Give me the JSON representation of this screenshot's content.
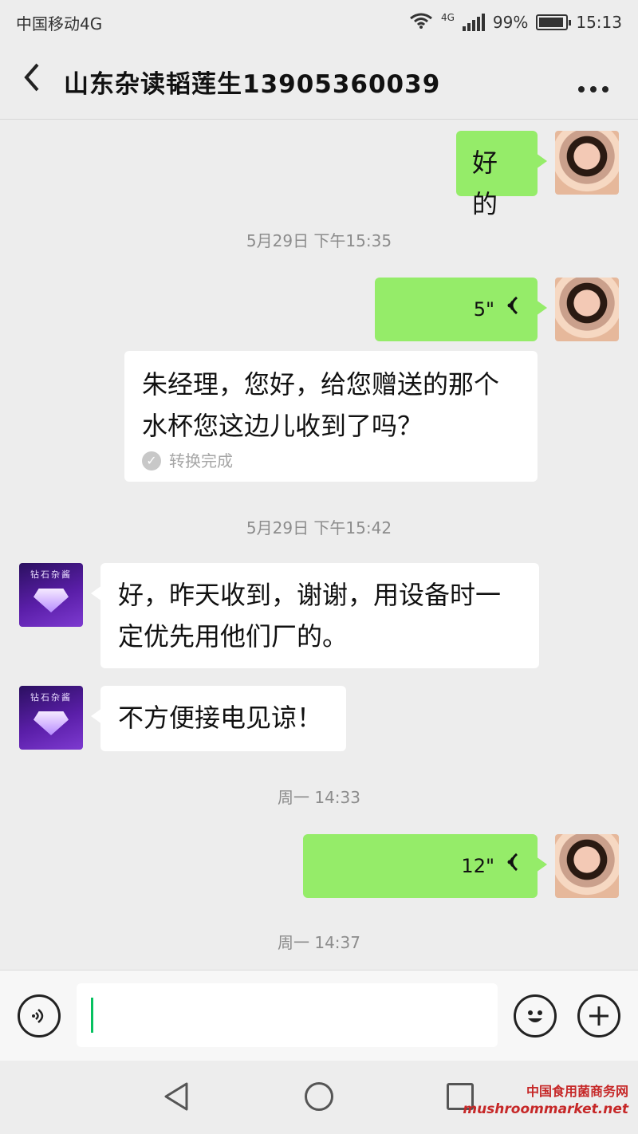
{
  "status_bar": {
    "carrier": "中国移动4G",
    "network": "4G",
    "battery": "99%",
    "time": "15:13"
  },
  "header": {
    "title": "山东杂读韬莲生13905360039"
  },
  "messages": [
    {
      "type": "text",
      "side": "right",
      "text": "好的"
    },
    {
      "type": "timestamp",
      "text": "5月29日 下午15:35"
    },
    {
      "type": "voice",
      "side": "right",
      "duration": "5\""
    },
    {
      "type": "transcript",
      "text": "朱经理，您好，给您赠送的那个水杯您这边儿收到了吗？",
      "status": "转换完成"
    },
    {
      "type": "timestamp",
      "text": "5月29日 下午15:42"
    },
    {
      "type": "text",
      "side": "left",
      "text": "好，昨天收到，谢谢，用设备时一定优先用他们厂的。",
      "avatar_text": "钻石杂酱"
    },
    {
      "type": "text",
      "side": "left",
      "text": "不方便接电见谅！",
      "avatar_text": "钻石杂酱"
    },
    {
      "type": "timestamp",
      "text": "周一 14:33"
    },
    {
      "type": "voice",
      "side": "right",
      "duration": "12\""
    },
    {
      "type": "timestamp",
      "text": "周一 14:37"
    }
  ],
  "watermark": {
    "cn": "中国食用菌商务网",
    "en": "mushroommarket.net"
  },
  "colors": {
    "sent_bubble": "#95ec69",
    "received_bubble": "#ffffff",
    "background": "#ededed"
  },
  "icons": [
    "back-arrow-icon",
    "more-icon",
    "voice-mode-icon",
    "emoji-icon",
    "plus-icon",
    "nav-back-icon",
    "nav-home-icon",
    "nav-recent-icon"
  ]
}
